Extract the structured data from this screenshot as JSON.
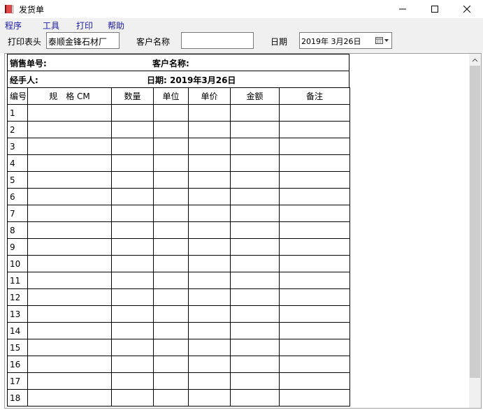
{
  "window": {
    "title": "发货单",
    "icon": "book-icon",
    "controls": {
      "minimize": "—",
      "maximize": "☐",
      "close": "✕"
    }
  },
  "menu": [
    {
      "label": "程序"
    },
    {
      "label": "工具"
    },
    {
      "label": "打印"
    },
    {
      "label": "帮助"
    }
  ],
  "toolbar": {
    "print_header_label": "打印表头",
    "print_header_value": "泰顺金锋石材厂",
    "customer_label": "客户名称",
    "customer_value": "",
    "date_label": "日期",
    "date_value": "2019年  3月26日"
  },
  "sheet": {
    "order_no_label": "销售单号:",
    "customer_label": "客户名称:",
    "handler_label": "经手人:",
    "date_text": "日期: 2019年3月26日",
    "columns": [
      "编号",
      "规　格 CM",
      "数量",
      "单位",
      "单价",
      "金额",
      "备注"
    ],
    "row_numbers": [
      "1",
      "2",
      "3",
      "4",
      "5",
      "6",
      "7",
      "8",
      "9",
      "10",
      "11",
      "12",
      "13",
      "14",
      "15",
      "16",
      "17",
      "18"
    ]
  }
}
